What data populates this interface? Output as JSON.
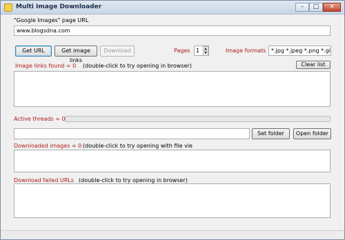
{
  "window": {
    "title": "Multi Image Downloader",
    "minimize": "–",
    "maximize": "□",
    "close": "✕"
  },
  "url_section": {
    "label": "\"Google Images\" page URL",
    "value": "www.blogsdna.com"
  },
  "toolbar": {
    "get_url": "Get URL",
    "get_image_links": "Get image links",
    "download": "Download",
    "pages_label": "Pages",
    "pages_value": "1",
    "image_formats_label": "Image formats",
    "image_formats_value": "*.jpg *.jpeg *.png *.gif *.bmp"
  },
  "image_links": {
    "label": "Image links found = 0",
    "hint": "(double-click to try opening in browser)",
    "clear_list": "Clear list"
  },
  "threads": {
    "label": "Active threads = 0",
    "progress": 0
  },
  "folder": {
    "value": "",
    "set_folder": "Set folder",
    "open_folder": "Open folder"
  },
  "downloaded": {
    "label": "Downloaded images = 0",
    "hint": "(double-click to try opening with file vie"
  },
  "failed": {
    "label": "Download failed URLs",
    "hint": "(double-click to try opening in browser)"
  },
  "colors": {
    "accent_red": "#b01818",
    "window_bg": "#f0f0f0"
  }
}
